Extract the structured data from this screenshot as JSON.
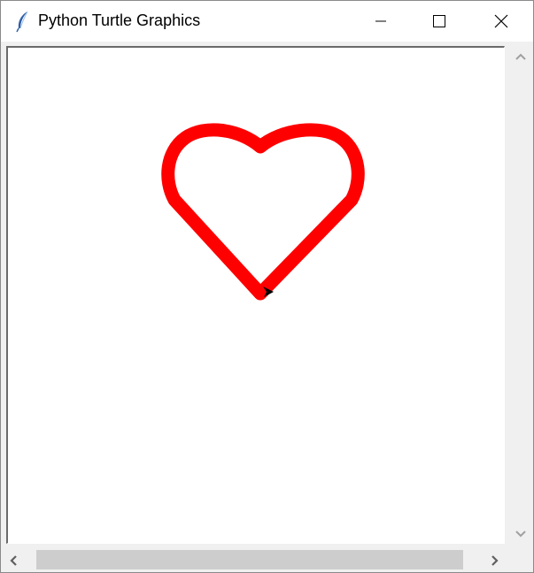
{
  "window": {
    "title": "Python Turtle Graphics",
    "app_icon": "feather-icon",
    "controls": {
      "minimize_icon": "minimize-icon",
      "maximize_icon": "maximize-icon",
      "close_icon": "close-icon"
    }
  },
  "canvas": {
    "background": "#ffffff",
    "drawing": {
      "shape": "heart",
      "stroke_color": "#ff0000",
      "turtle_icon": "turtle-arrow-icon",
      "turtle_color": "#000000"
    }
  },
  "scrollbars": {
    "vertical": {
      "up_icon": "chevron-up-icon",
      "down_icon": "chevron-down-icon"
    },
    "horizontal": {
      "left_icon": "chevron-left-icon",
      "right_icon": "chevron-right-icon"
    }
  }
}
